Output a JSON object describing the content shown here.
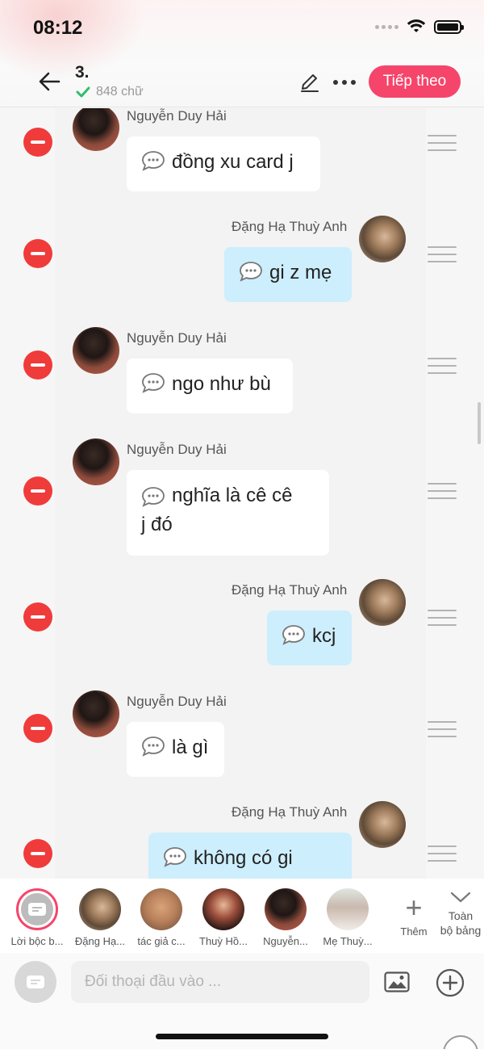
{
  "status_bar": {
    "time": "08:12"
  },
  "header": {
    "chapter_title": "3.",
    "word_count": "848 chữ",
    "next_button": "Tiếp theo"
  },
  "messages": [
    {
      "side": "left",
      "sender": "Nguyễn Duy Hải",
      "text": "đồng xu card j"
    },
    {
      "side": "right",
      "sender": "Đặng Hạ Thuỳ Anh",
      "text": "gi z mẹ"
    },
    {
      "side": "left",
      "sender": "Nguyễn Duy Hải",
      "text": "ngo như bù"
    },
    {
      "side": "left",
      "sender": "Nguyễn Duy Hải",
      "text": "nghĩa là cê cê\nj đó"
    },
    {
      "side": "right",
      "sender": "Đặng Hạ Thuỳ Anh",
      "text": "kcj"
    },
    {
      "side": "left",
      "sender": "Nguyễn Duy Hải",
      "text": "là gì"
    },
    {
      "side": "right",
      "sender": "Đặng Hạ Thuỳ Anh",
      "text": "không có gi"
    }
  ],
  "characters": [
    {
      "name": "Lời bộc b...",
      "kind": "narration",
      "selected": true
    },
    {
      "name": "Đặng Hạ...",
      "kind": "girl"
    },
    {
      "name": "tác giả c...",
      "kind": "author"
    },
    {
      "name": "Thuỳ Hồ...",
      "kind": "woman"
    },
    {
      "name": "Nguyễn...",
      "kind": "boy"
    },
    {
      "name": "Mẹ Thuỳ...",
      "kind": "mother"
    }
  ],
  "add_character_label": "Thêm",
  "expand_label": "Toàn\nbộ bảng",
  "input": {
    "placeholder": "Đối thoại đầu vào ..."
  },
  "colors": {
    "accent": "#f5456b",
    "delete": "#f03b3b",
    "right_bubble": "#cdeefc",
    "left_bubble": "#ffffff"
  }
}
